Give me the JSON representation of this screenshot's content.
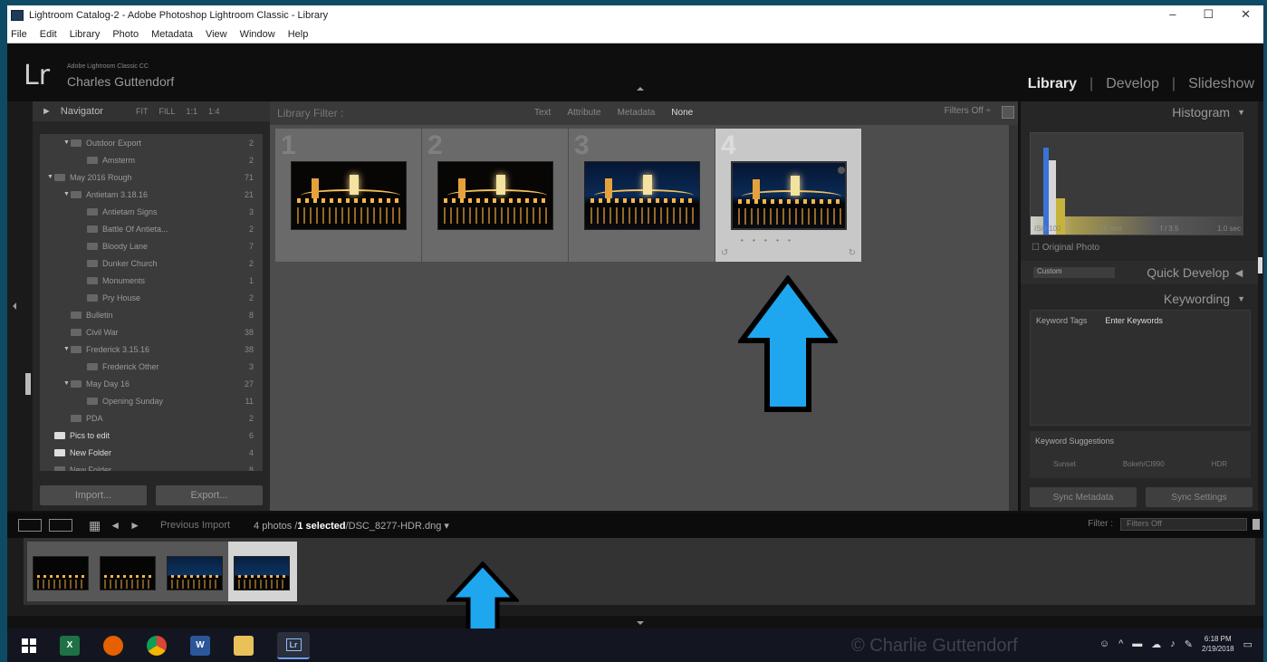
{
  "window": {
    "title": "Lightroom Catalog-2 - Adobe Photoshop Lightroom Classic - Library",
    "controls": {
      "minimize": "–",
      "maximize": "☐",
      "close": "✕"
    }
  },
  "menu": [
    "File",
    "Edit",
    "Library",
    "Photo",
    "Metadata",
    "View",
    "Window",
    "Help"
  ],
  "identity": {
    "logo": "Lr",
    "product": "Adobe Lightroom Classic CC",
    "user": "Charles Guttendorf"
  },
  "modules": [
    "Library",
    "Develop",
    "Slideshow"
  ],
  "navigator": {
    "label": "Navigator",
    "zoom_levels": [
      "FIT",
      "FILL",
      "1:1",
      "1:4"
    ]
  },
  "folders": [
    {
      "label": "Outdoor Export",
      "count": "2",
      "indent": 1,
      "arrow": "▼"
    },
    {
      "label": "Amsterm",
      "count": "2",
      "indent": 2,
      "arrow": ""
    },
    {
      "label": "May 2016 Rough",
      "count": "71",
      "indent": 0,
      "arrow": "▼"
    },
    {
      "label": "Antietam 3.18.16",
      "count": "21",
      "indent": 1,
      "arrow": "▼"
    },
    {
      "label": "Antietam Signs",
      "count": "3",
      "indent": 2,
      "arrow": ""
    },
    {
      "label": "Battle Of Antieta...",
      "count": "2",
      "indent": 2,
      "arrow": ""
    },
    {
      "label": "Bloody Lane",
      "count": "7",
      "indent": 2,
      "arrow": ""
    },
    {
      "label": "Dunker Church",
      "count": "2",
      "indent": 2,
      "arrow": ""
    },
    {
      "label": "Monuments",
      "count": "1",
      "indent": 2,
      "arrow": ""
    },
    {
      "label": "Pry House",
      "count": "2",
      "indent": 2,
      "arrow": ""
    },
    {
      "label": "Bulletin",
      "count": "8",
      "indent": 1,
      "arrow": ""
    },
    {
      "label": "Civil War",
      "count": "38",
      "indent": 1,
      "arrow": ""
    },
    {
      "label": "Frederick 3.15.16",
      "count": "38",
      "indent": 1,
      "arrow": "▼"
    },
    {
      "label": "Frederick Other",
      "count": "3",
      "indent": 2,
      "arrow": ""
    },
    {
      "label": "May Day 16",
      "count": "27",
      "indent": 1,
      "arrow": "▼"
    },
    {
      "label": "Opening Sunday",
      "count": "11",
      "indent": 2,
      "arrow": ""
    },
    {
      "label": "PDA",
      "count": "2",
      "indent": 1,
      "arrow": ""
    },
    {
      "label": "Pics to edit",
      "count": "6",
      "indent": 0,
      "arrow": "",
      "bold": true,
      "folder": true
    },
    {
      "label": "New Folder",
      "count": "4",
      "indent": 0,
      "arrow": "",
      "bold": true,
      "folder": true
    },
    {
      "label": "New Folder",
      "count": "8",
      "indent": 0,
      "arrow": ""
    }
  ],
  "left_buttons": {
    "import": "Import...",
    "export": "Export..."
  },
  "library_filter": {
    "label": "Library Filter :",
    "options": [
      "Text",
      "Attribute",
      "Metadata",
      "None"
    ],
    "active": "None",
    "preset": "Filters Off ÷"
  },
  "grid": [
    {
      "number": "1",
      "selected": false,
      "style": "dark"
    },
    {
      "number": "2",
      "selected": false,
      "style": "dark"
    },
    {
      "number": "3",
      "selected": false,
      "style": "blue"
    },
    {
      "number": "4",
      "selected": true,
      "style": "blue"
    }
  ],
  "right_panel": {
    "histogram": "Histogram",
    "histo_info": [
      "ISO 100",
      "15 mm",
      "f / 3.5",
      "1.0 sec"
    ],
    "original_photo": "Original Photo",
    "quick_develop": "Quick Develop",
    "quick_preset": "Custom",
    "keywording": "Keywording",
    "keyword_tags": "Keyword Tags",
    "enter_keywords": "Enter Keywords",
    "keyword_suggestions": "Keyword Suggestions",
    "suggestions": [
      "Sunset",
      "Bokeh/Cl990",
      "HDR"
    ],
    "sync_metadata": "Sync Metadata",
    "sync_settings": "Sync Settings"
  },
  "toolbar": {
    "source": "Previous Import",
    "photos": "4 photos /",
    "selected": "1 selected",
    "filename": "/DSC_8277-HDR.dng ▾",
    "filter_label": "Filter :",
    "filter_value": "Filters Off"
  },
  "filmstrip": [
    {
      "style": "dark",
      "selected": false
    },
    {
      "style": "dark",
      "selected": false
    },
    {
      "style": "blue",
      "selected": false
    },
    {
      "style": "blue",
      "selected": true
    }
  ],
  "taskbar": {
    "watermark": "© Charlie Guttendorf",
    "time": "6:18 PM",
    "date": "2/19/2018",
    "apps": [
      "excel-icon",
      "firefox-icon",
      "chrome-icon",
      "word-icon",
      "explorer-icon",
      "lightroom-icon"
    ]
  },
  "colors": {
    "callout_arrow": "#1ea7ef",
    "selected_cell": "#c8c8c8",
    "accent": "#6aa0ff"
  }
}
